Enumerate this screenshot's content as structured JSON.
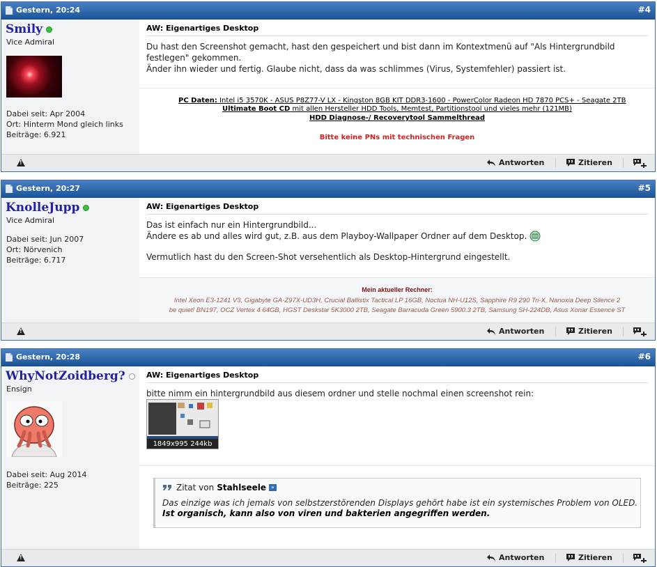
{
  "posts": [
    {
      "date": "Gestern, 20:24",
      "number": "#4",
      "user": {
        "name": "Smily",
        "status": "online",
        "rank": "Vice Admiral",
        "joined": "Dabei seit: Apr 2004",
        "location": "Ort: Hinterm Mond gleich links",
        "posts": "Beiträge: 6.921"
      },
      "title": "AW: Eigenartiges Desktop",
      "body": [
        "Du hast den Screenshot gemacht, hast den gespeichert und bist dann im Kontextmenü auf \"Als Hintergrundbild festlegen\" gekommen.",
        "Änder ihn wieder und fertig. Glaube nicht, dass da was schlimmes (Virus, Systemfehler) passiert ist."
      ],
      "signature": {
        "pc_label": "PC Daten:",
        "pc_text": " Intel i5 3570K - ASUS P8Z77-V LX - Kingston 8GB KIT DDR3-1600 - PowerColor Radeon HD 7870 PCS+ - Seagate 2TB",
        "line2_bold": "Ultimate Boot CD",
        "line2_rest": " mit allen Hersteller HDD Tools, Memtest, Partitionstool und vieles mehr (121MB)",
        "line3": "HDD Diagnose-/ Recoverytool Sammelthread",
        "line4": "Bitte keine PNs mit technischen Fragen"
      }
    },
    {
      "date": "Gestern, 20:27",
      "number": "#5",
      "user": {
        "name": "KnolleJupp",
        "status": "online",
        "rank": "Vice Admiral",
        "joined": "Dabei seit: Jun 2007",
        "location": "Ort: Nörvenich",
        "posts": "Beiträge: 6.717"
      },
      "title": "AW: Eigenartiges Desktop",
      "body": [
        "Das ist einfach nur ein Hintergrundbild...",
        "Ändere es ab und alles wird gut, z.B. aus dem Playboy-Wallpaper Ordner auf dem Desktop.",
        "Vermutlich hast du den Screen-Shot versehentlich als Desktop-Hintergrund eingestellt."
      ],
      "signature": {
        "heading": "Mein aktueller Rechner:",
        "line1": "Intel Xeon E3-1241 V3, Gigabyte GA-Z97X-UD3H, Crucial Ballistix Tactical LP 16GB, Noctua NH-U12S, Sapphire R9 290 Tri-X, Nanoxia Deep Silence 2",
        "line2": "be quiet! BN197, OCZ Vertex 4 64GB, HGST Deskstar 5K3000 2TB, Seagate Barracuda Green 5900.3 2TB, Samsung SH-224DB, Asus Xonar Essence ST"
      }
    },
    {
      "date": "Gestern, 20:28",
      "number": "#6",
      "user": {
        "name": "WhyNotZoidberg?",
        "status": "offline",
        "rank": "Ensign",
        "joined": "Dabei seit: Aug 2014",
        "posts": "Beiträge: 225"
      },
      "title": "AW: Eigenartiges Desktop",
      "body": [
        "bitte nimm ein hintergrundbild aus diesem ordner und stelle nochmal einen screenshot rein:"
      ],
      "attachment_caption": "1849x995 244kb",
      "quote": {
        "prefix": "Zitat von",
        "author": "Stahlseele",
        "line1": "Das einzige was ich jemals von selbstzerstörenden Displays gehört habe ist ein systemisches Problem von OLED.",
        "line2": "Ist organisch, kann also von viren und bakterien angegriffen werden."
      }
    }
  ],
  "actions": {
    "reply": "Antworten",
    "quote": "Zitieren"
  },
  "colors": {
    "header_blue": "#1c5698",
    "username": "#22229c",
    "sig_red": "#d81f1f",
    "sig_dark_red": "#7a1010"
  }
}
